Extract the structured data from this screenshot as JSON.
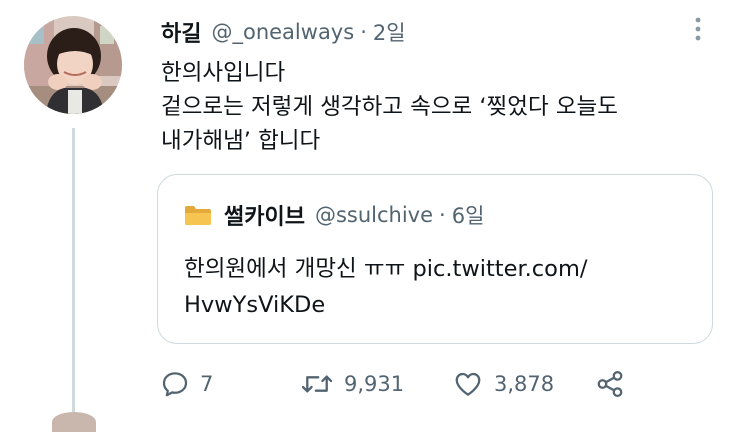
{
  "tweet": {
    "display_name": "하길",
    "handle": "@_onealways",
    "separator": "·",
    "time": "2일",
    "text_lines": [
      "한의사입니다",
      "겉으로는 저렇게 생각하고 속으로 ‘찢었다 오늘도",
      "내가해냄’ 합니다"
    ]
  },
  "quote": {
    "icon": "folder-icon",
    "display_name": "썰카이브",
    "handle": "@ssulchive",
    "separator": "·",
    "time": "6일",
    "text_lines": [
      "한의원에서 개망신 ㅠㅠ pic.twitter.com/",
      "HvwYsViKDe"
    ]
  },
  "actions": {
    "reply_count": "7",
    "retweet_count": "9,931",
    "like_count": "3,878"
  },
  "colors": {
    "text_primary": "#0f1419",
    "text_secondary": "#536471",
    "border": "#cfd9de"
  }
}
